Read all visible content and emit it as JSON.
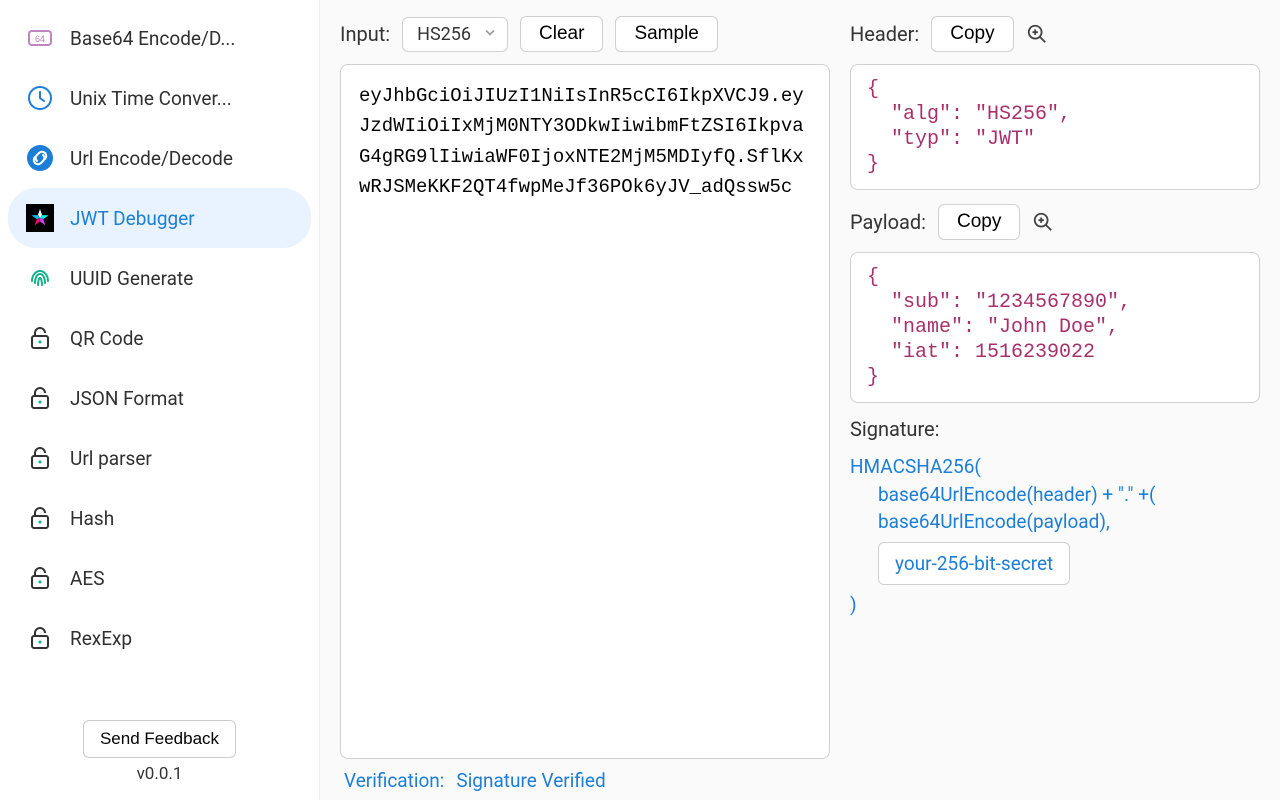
{
  "sidebar": {
    "items": [
      {
        "label": "Base64 Encode/D...",
        "icon": "base64"
      },
      {
        "label": "Unix Time Conver...",
        "icon": "clock"
      },
      {
        "label": "Url Encode/Decode",
        "icon": "link"
      },
      {
        "label": "JWT Debugger",
        "icon": "jwt"
      },
      {
        "label": "UUID Generate",
        "icon": "fingerprint"
      },
      {
        "label": "QR Code",
        "icon": "lock"
      },
      {
        "label": "JSON Format",
        "icon": "lock"
      },
      {
        "label": "Url parser",
        "icon": "lock"
      },
      {
        "label": "Hash",
        "icon": "lock"
      },
      {
        "label": "AES",
        "icon": "lock"
      },
      {
        "label": "RexExp",
        "icon": "lock"
      }
    ],
    "feedback_label": "Send Feedback",
    "version_label": "v0.0.1"
  },
  "input": {
    "label": "Input:",
    "algo_select": "HS256",
    "clear_label": "Clear",
    "sample_label": "Sample",
    "value": "eyJhbGciOiJIUzI1NiIsInR5cCI6IkpXVCJ9.eyJzdWIiOiIxMjM0NTY3ODkwIiwibmFtZSI6IkpvaG4gRG9lIiwiaWF0IjoxNTE2MjM5MDIyfQ.SflKxwRJSMeKKF2QT4fwpMeJf36POk6yJV_adQssw5c"
  },
  "header": {
    "label": "Header:",
    "copy_label": "Copy",
    "code": "{\n  \"alg\": \"HS256\",\n  \"typ\": \"JWT\"\n}"
  },
  "payload": {
    "label": "Payload:",
    "copy_label": "Copy",
    "code": "{\n  \"sub\": \"1234567890\",\n  \"name\": \"John Doe\",\n  \"iat\": 1516239022\n}"
  },
  "signature": {
    "label": "Signature:",
    "line1": "HMACSHA256(",
    "line2": "base64UrlEncode(header) + \".\" +(",
    "line3": "base64UrlEncode(payload),",
    "secret": "your-256-bit-secret",
    "line4": ")"
  },
  "verification": {
    "label": "Verification:",
    "status": "Signature Verified"
  }
}
